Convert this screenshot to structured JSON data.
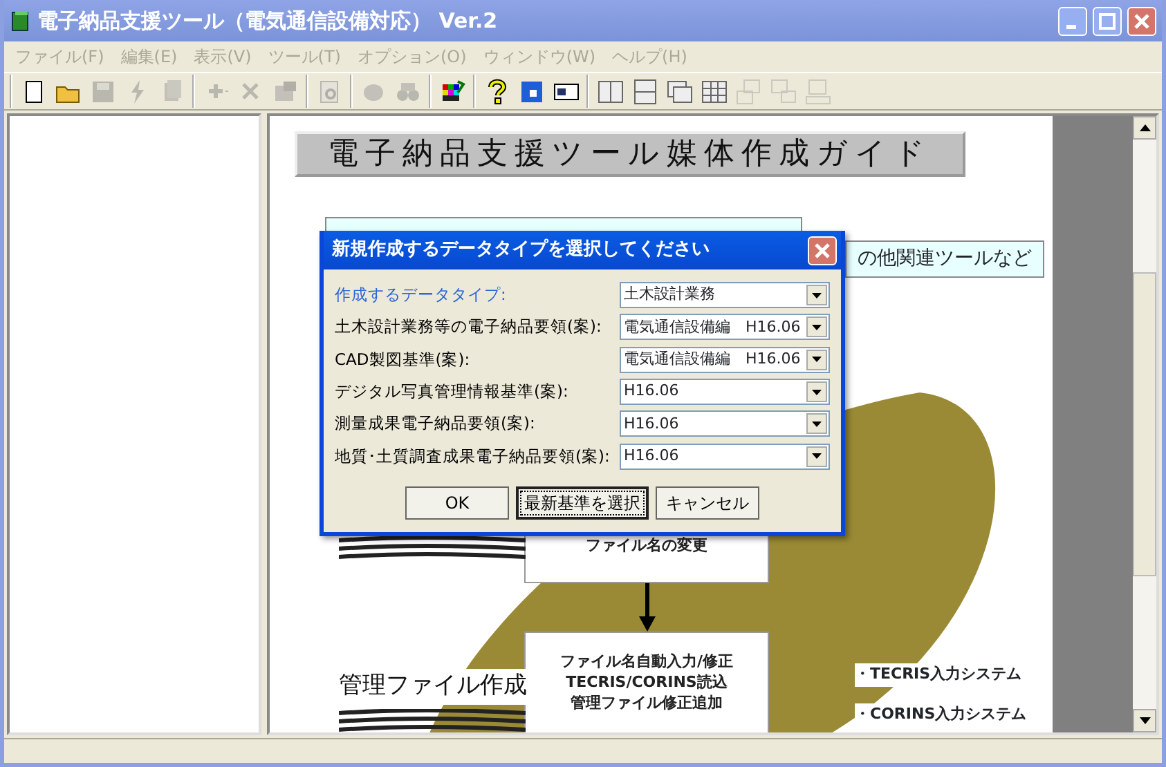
{
  "window": {
    "title": "電子納品支援ツール（電気通信設備対応） Ver.2"
  },
  "menu": [
    {
      "label": "ファイル(F)",
      "disabled": true
    },
    {
      "label": "編集(E)",
      "disabled": true
    },
    {
      "label": "表示(V)",
      "disabled": true
    },
    {
      "label": "ツール(T)",
      "disabled": true
    },
    {
      "label": "オプション(O)",
      "disabled": true
    },
    {
      "label": "ウィンドウ(W)",
      "disabled": true
    },
    {
      "label": "ヘルプ(H)",
      "disabled": true
    }
  ],
  "toolbar": [
    [
      {
        "kind": "new",
        "disabled": false
      },
      {
        "kind": "open",
        "disabled": false
      },
      {
        "kind": "save",
        "disabled": true
      },
      {
        "kind": "bolt",
        "disabled": true
      },
      {
        "kind": "stack",
        "disabled": true
      }
    ],
    [
      {
        "kind": "plus",
        "disabled": true
      },
      {
        "kind": "cross",
        "disabled": true
      },
      {
        "kind": "props",
        "disabled": true
      }
    ],
    [
      {
        "kind": "preview",
        "disabled": true
      }
    ],
    [
      {
        "kind": "stamp",
        "disabled": true
      },
      {
        "kind": "binoculars",
        "disabled": true
      }
    ],
    [
      {
        "kind": "grid",
        "disabled": false
      }
    ],
    [
      {
        "kind": "help",
        "disabled": false
      },
      {
        "kind": "window",
        "disabled": false
      },
      {
        "kind": "card",
        "disabled": false
      }
    ],
    [
      {
        "kind": "cols",
        "disabled": false
      },
      {
        "kind": "rows",
        "disabled": false
      },
      {
        "kind": "cascade",
        "disabled": false
      },
      {
        "kind": "tiles",
        "disabled": false
      },
      {
        "kind": "screens",
        "disabled": true
      },
      {
        "kind": "screens2",
        "disabled": true
      },
      {
        "kind": "network",
        "disabled": true
      }
    ]
  ],
  "guide": {
    "heading": "電子納品支援ツール媒体作成ガイド",
    "other_tools": "の他関連ツールなど",
    "step_box_1": "ファイル名の変更",
    "step_box_2": [
      "ファイル名自動入力/修正",
      "TECRIS/CORINS読込",
      "管理ファイル修正追加"
    ],
    "section_label": "管理ファイル作成",
    "systems": [
      "・TECRIS入力システム",
      "・CORINS入力システム"
    ]
  },
  "dialog": {
    "title": "新規作成するデータタイプを選択してください",
    "rows": [
      {
        "label": "作成するデータタイプ:",
        "value": "土木設計業務",
        "selected": true
      },
      {
        "label": "土木設計業務等の電子納品要領(案):",
        "value": "電気通信設備編　H16.06",
        "selected": false
      },
      {
        "label": "CAD製図基準(案):",
        "value": "電気通信設備編　H16.06",
        "selected": false
      },
      {
        "label": "デジタル写真管理情報基準(案):",
        "value": "H16.06",
        "selected": false
      },
      {
        "label": "測量成果電子納品要領(案):",
        "value": "H16.06",
        "selected": false
      },
      {
        "label": "地質･土質調査成果電子納品要領(案):",
        "value": "H16.06",
        "selected": false
      }
    ],
    "buttons": [
      {
        "label": "OK",
        "focused": false
      },
      {
        "label": "最新基準を選択",
        "focused": true
      },
      {
        "label": "キャンセル",
        "focused": false
      }
    ]
  }
}
